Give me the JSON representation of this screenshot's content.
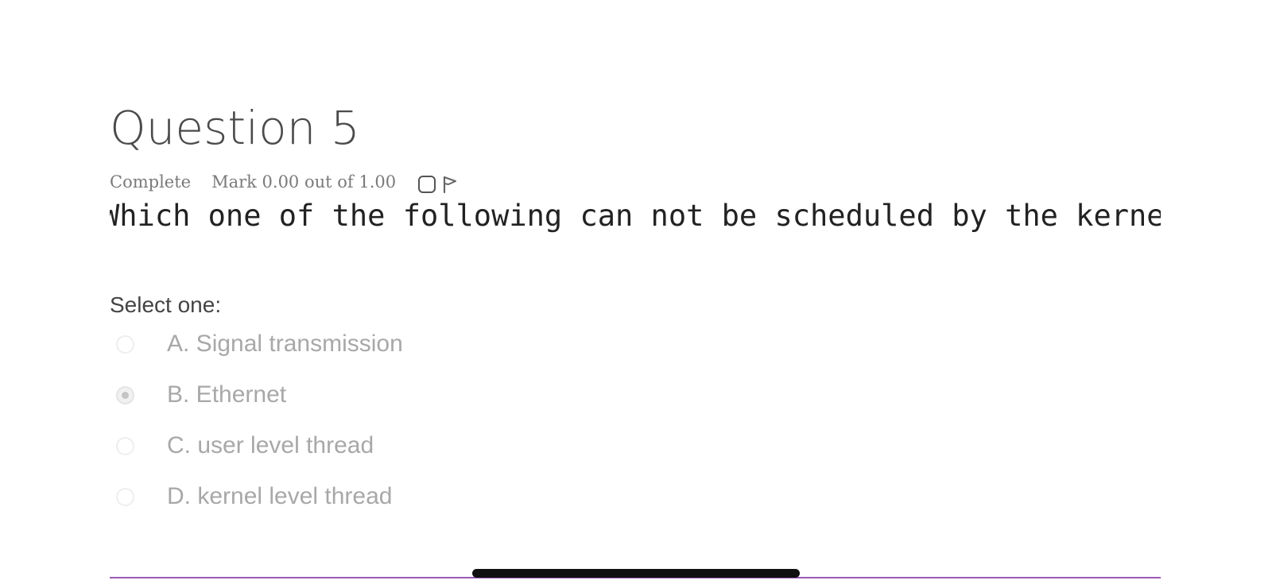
{
  "question": {
    "title": "Question 5",
    "status": "Complete",
    "mark": "Mark 0.00 out of 1.00",
    "text": "Which one of the following can not be scheduled by the kernel?",
    "select_label": "Select one:",
    "selected_index": 1,
    "options": [
      {
        "label": "A. Signal transmission",
        "selected": false
      },
      {
        "label": "B. Ethernet",
        "selected": true
      },
      {
        "label": "C. user level thread",
        "selected": false
      },
      {
        "label": "D. kernel level thread",
        "selected": false
      }
    ]
  },
  "icons": {
    "flag_checkbox": "checkbox-icon",
    "flag": "flag-icon"
  },
  "colors": {
    "title": "#4b4b4b",
    "meta": "#7a7a7a",
    "option_text": "#a8a8a8",
    "divider": "#9b59b6"
  }
}
